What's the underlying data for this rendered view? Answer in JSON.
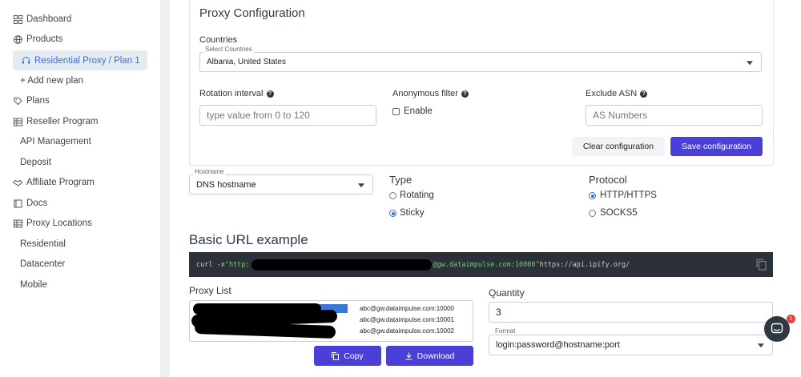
{
  "sidebar": {
    "items": [
      {
        "label": "Dashboard",
        "icon": "grid-icon"
      },
      {
        "label": "Products",
        "icon": "globe-icon"
      },
      {
        "label": "Residential Proxy / Plan 1",
        "icon": "headset-icon"
      },
      {
        "label": "+ Add new plan"
      },
      {
        "label": "Plans",
        "icon": "tag-icon"
      },
      {
        "label": "Reseller Program",
        "icon": "table-icon"
      },
      {
        "label": "API Management"
      },
      {
        "label": "Deposit"
      },
      {
        "label": "Affiliate Program",
        "icon": "handshake-icon"
      },
      {
        "label": "Docs",
        "icon": "book-icon"
      },
      {
        "label": "Proxy Locations",
        "icon": "table-icon"
      },
      {
        "label": "Residential"
      },
      {
        "label": "Datacenter"
      },
      {
        "label": "Mobile"
      }
    ]
  },
  "config": {
    "title": "Proxy Configuration",
    "countries_label": "Countries",
    "countries_select_label": "Select Countries",
    "countries_value": "Albania, United States",
    "rotation_label": "Rotation interval",
    "rotation_placeholder": "type value from 0 to 120",
    "anon_label": "Anonymous filter",
    "anon_enable": "Enable",
    "asn_label": "Exclude ASN",
    "asn_placeholder": "AS Numbers",
    "clear_button": "Clear configuration",
    "save_button": "Save configuration"
  },
  "hostname": {
    "label": "Hostname",
    "value": "DNS hostname"
  },
  "type": {
    "label": "Type",
    "options": [
      {
        "label": "Rotating",
        "selected": false
      },
      {
        "label": "Sticky",
        "selected": true
      }
    ]
  },
  "protocol": {
    "label": "Protocol",
    "options": [
      {
        "label": "HTTP/HTTPS",
        "selected": true
      },
      {
        "label": "SOCKS5",
        "selected": false
      }
    ]
  },
  "basic_url": {
    "title": "Basic URL example",
    "cmd_prefix": "curl -x ",
    "quote_open": "\"http:",
    "host_part": "@gw.dataimpulse.com:10000\"",
    "target": " https://api.ipify.org/"
  },
  "proxy_list": {
    "label": "Proxy List",
    "lines": [
      "abc@gw.dataimpulse.com:10000",
      "abc@gw.dataimpulse.com:10001",
      "abc@gw.dataimpulse.com:10002"
    ]
  },
  "quantity": {
    "label": "Quantity",
    "value": "3"
  },
  "format": {
    "label": "Format",
    "value": "login:password@hostname:port"
  },
  "buttons": {
    "copy": "Copy",
    "download": "Download"
  },
  "chat": {
    "badge": "1"
  },
  "colors": {
    "primary": "#4a3fd6",
    "accent": "#3b6fd1",
    "code_bg": "#2b3039"
  }
}
